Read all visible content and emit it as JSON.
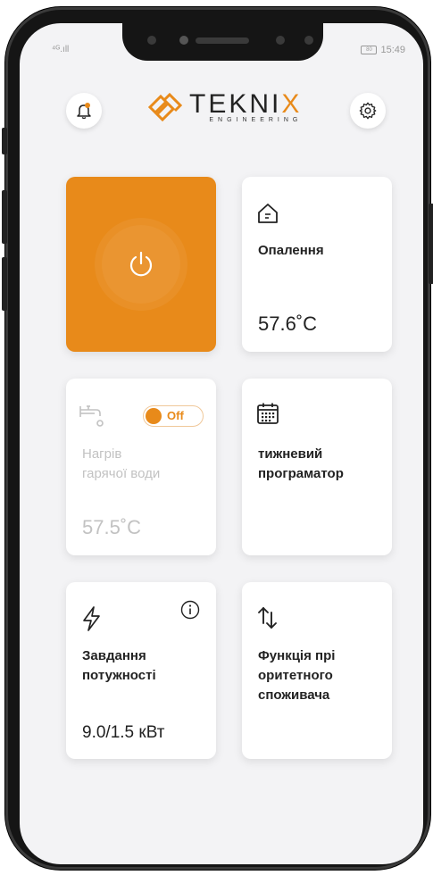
{
  "status_bar": {
    "signal": "⁴ᴳ.ıll",
    "battery": "80",
    "time": "15:49"
  },
  "header": {
    "brand_prefix": "TEKNI",
    "brand_x": "X",
    "brand_sub": "ENGINEERING"
  },
  "colors": {
    "accent": "#e88a1a",
    "screen_bg": "#f3f3f5",
    "card_bg": "#ffffff",
    "disabled_text": "#c2c2c2"
  },
  "cards": {
    "heating": {
      "icon": "home-thermostat-icon",
      "title": "Опалення",
      "value": "57.6˚C"
    },
    "hot_water": {
      "icon": "water-tap-icon",
      "title_line1": "Нагрів",
      "title_line2": "гарячої води",
      "value": "57.5˚C",
      "toggle_label": "Off"
    },
    "weekly": {
      "icon": "calendar-icon",
      "title_line1": "тижневий",
      "title_line2": "програматор"
    },
    "power": {
      "icon": "lightning-icon",
      "info_icon": "info-icon",
      "title_line1": "Завдання",
      "title_line2": "потужності",
      "value": "9.0/1.5 кВт"
    },
    "priority": {
      "icon": "arrows-up-down-icon",
      "title_line1": "Функція прі",
      "title_line2": "оритетного",
      "title_line3": "споживача"
    }
  }
}
